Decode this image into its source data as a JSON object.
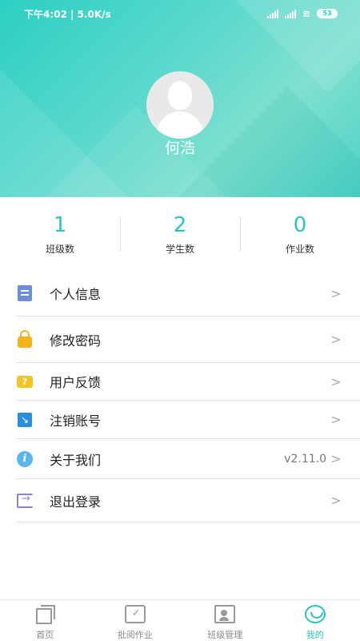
{
  "status_bar": {
    "time_speed": "下午4:02 | 5.0K/s",
    "battery": "53"
  },
  "profile": {
    "username": "何浩"
  },
  "stats": [
    {
      "value": "1",
      "label": "班级数"
    },
    {
      "value": "2",
      "label": "学生数"
    },
    {
      "value": "0",
      "label": "作业数"
    }
  ],
  "menu": [
    {
      "label": "个人信息",
      "icon": "document-icon",
      "value": "",
      "color": "#6f8cd6"
    },
    {
      "label": "修改密码",
      "icon": "lock-icon",
      "value": "",
      "color": "#f2b51b"
    },
    {
      "label": "用户反馈",
      "icon": "feedback-icon",
      "value": "",
      "color": "#f4c522"
    },
    {
      "label": "注销账号",
      "icon": "cancel-account-icon",
      "value": "",
      "color": "#2a8ee0"
    },
    {
      "label": "关于我们",
      "icon": "info-icon",
      "value": "v2.11.0",
      "color": "#59b7ec"
    },
    {
      "label": "退出登录",
      "icon": "logout-icon",
      "value": "",
      "color": "#8c82d6"
    }
  ],
  "chevron": ">",
  "tabbar": [
    {
      "label": "首页",
      "icon": "home-icon",
      "active": false
    },
    {
      "label": "批阅作业",
      "icon": "review-homework-icon",
      "active": false
    },
    {
      "label": "班级管理",
      "icon": "class-management-icon",
      "active": false
    },
    {
      "label": "我的",
      "icon": "mine-icon",
      "active": true
    }
  ],
  "colors": {
    "accent": "#2ac3bb",
    "header_gradient_start": "#2ccfc4",
    "header_gradient_end": "#7fe0d0"
  }
}
